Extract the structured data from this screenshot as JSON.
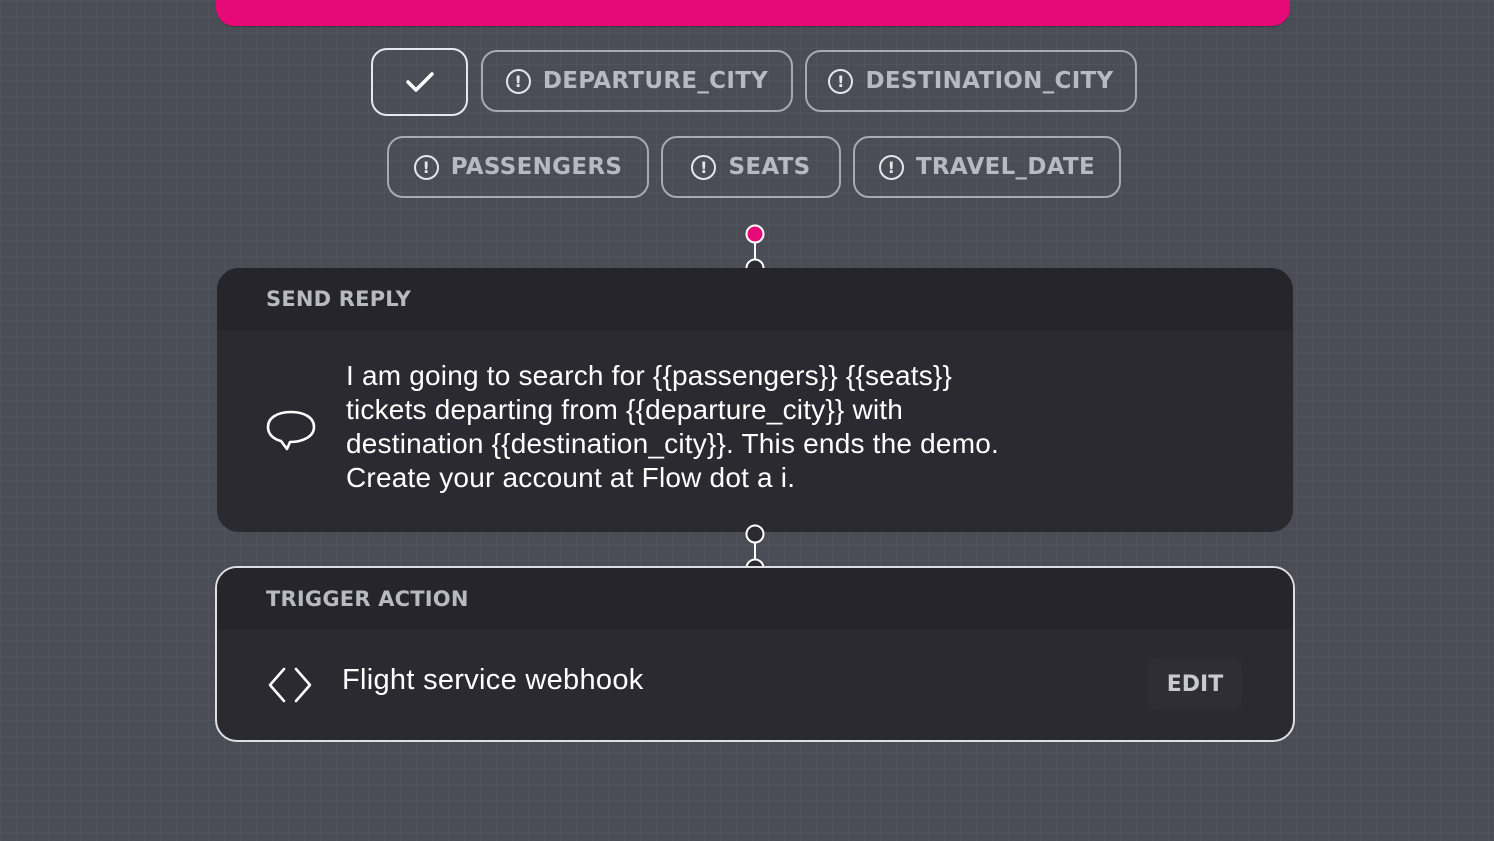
{
  "variables": [
    {
      "name": "DEPARTURE_CITY"
    },
    {
      "name": "DESTINATION_CITY"
    },
    {
      "name": "PASSENGERS"
    },
    {
      "name": "SEATS"
    },
    {
      "name": "TRAVEL_DATE"
    }
  ],
  "send_reply": {
    "header": "SEND REPLY",
    "icon": "speech-bubble-icon",
    "lines": [
      "I am going to search for {{passengers}} {{seats}}",
      "tickets departing from {{departure_city}} with",
      "destination {{destination_city}}. This ends the demo.",
      "Create your account at Flow dot a i."
    ]
  },
  "trigger_action": {
    "header": "TRIGGER ACTION",
    "icon": "code-icon",
    "title": "Flight service webhook",
    "edit_label": "EDIT"
  },
  "colors": {
    "accent": "#e60a78",
    "canvas": "#4b4d56",
    "card": "#2b2a31"
  }
}
